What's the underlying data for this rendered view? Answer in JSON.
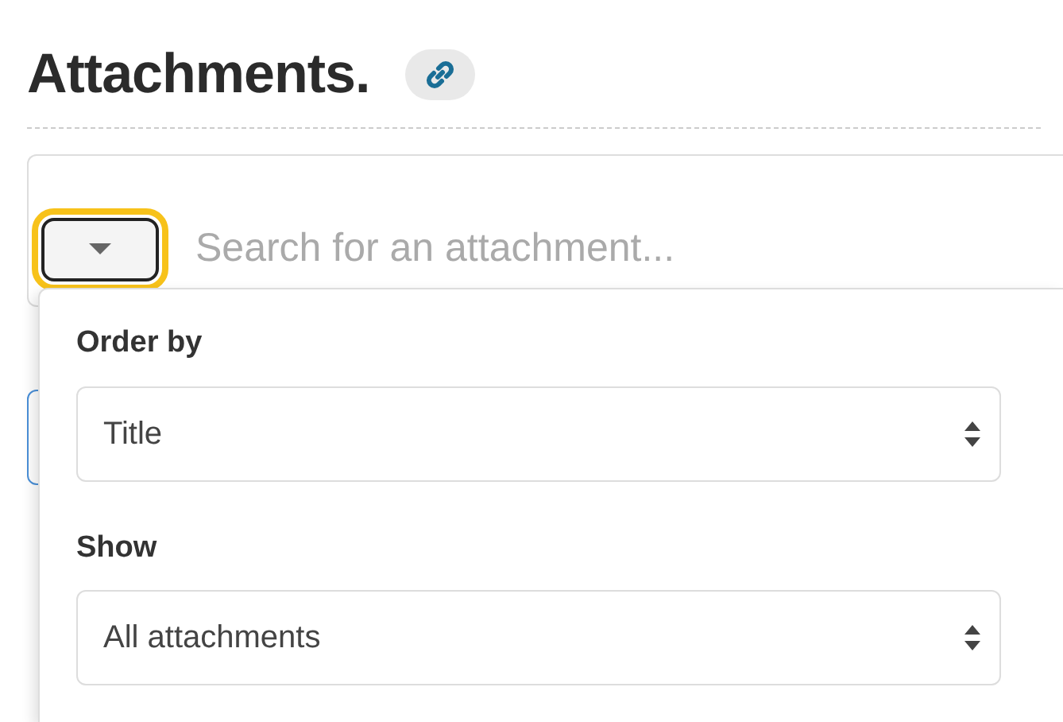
{
  "heading": {
    "title": "Attachments."
  },
  "search": {
    "toggle": {
      "expanded": true,
      "focused": true
    },
    "placeholder": "Search for an attachment..."
  },
  "dropdown": {
    "fields": [
      {
        "label": "Order by",
        "value": "Title"
      },
      {
        "label": "Show",
        "value": "All attachments"
      }
    ]
  }
}
